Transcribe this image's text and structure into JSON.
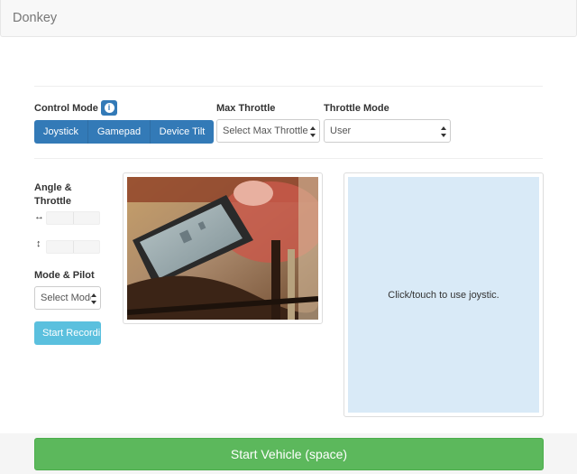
{
  "navbar": {
    "brand": "Donkey"
  },
  "control_mode": {
    "label": "Control Mode",
    "info_icon": "info-icon",
    "options": [
      "Joystick",
      "Gamepad",
      "Device Tilt"
    ]
  },
  "max_throttle": {
    "label": "Max Throttle",
    "value": "Select Max Throttle"
  },
  "throttle_mode": {
    "label": "Throttle Mode",
    "value": "User"
  },
  "angle_throttle": {
    "label_line1": "Angle &",
    "label_line2": "Throttle",
    "angle_icon": "↔",
    "throttle_icon": "↕"
  },
  "mode_pilot": {
    "label": "Mode & Pilot",
    "value": "Select Mode"
  },
  "record_button": {
    "label": "Start Recording"
  },
  "joystick": {
    "hint": "Click/touch to use joystic."
  },
  "start_vehicle": {
    "label": "Start Vehicle (space)"
  },
  "colors": {
    "primary": "#337ab7",
    "info": "#5bc0de",
    "success": "#5cb85c",
    "joystick_bg": "#d9eaf7"
  }
}
